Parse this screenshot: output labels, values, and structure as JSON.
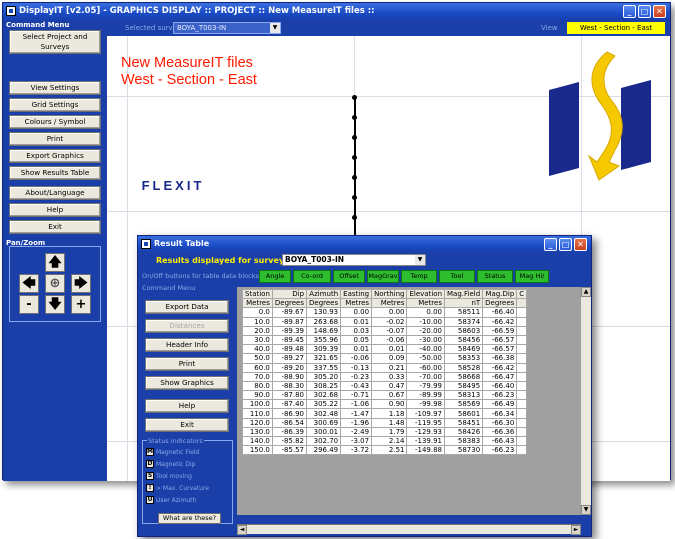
{
  "main": {
    "title": "DisplayIT [v2.05] - GRAPHICS DISPLAY :: PROJECT :: New MeasureIT files ::",
    "survey_label": "Selected survey",
    "survey_value": "BOYA_T003-IN",
    "view_label": "View",
    "view_value": "West - Section - East"
  },
  "command_menu": {
    "label": "Command Menu",
    "buttons": [
      "Select Project and Surveys",
      "View Settings",
      "Grid Settings",
      "Colours / Symbol",
      "Print",
      "Export Graphics",
      "Show Results Table",
      "About/Language",
      "Help",
      "Exit"
    ],
    "panzoom_label": "Pan/Zoom",
    "pan_up": "🡅",
    "pan_left": "🡄",
    "pan_center": "⊕",
    "pan_right": "🡆",
    "zoom_out": "-",
    "pan_down": "🡇",
    "zoom_in": "+"
  },
  "graphics": {
    "title_line1": "New MeasureIT files",
    "title_line2": "West - Section - East",
    "logo_text": "FLEXIT",
    "logo_colors": {
      "blue": "#1a2a8c",
      "yellow": "#f5c800"
    }
  },
  "result_window": {
    "title": "Result Table",
    "results_label": "Results displayed for survey",
    "survey_value": "BOYA_T003-IN",
    "onoff_label": "On/Off buttons for table data blocks",
    "toggles": [
      "Angle",
      "Co-ord",
      "Offset",
      "MagGrav",
      "Temp",
      "Tool",
      "Status",
      "Mag Hi/"
    ],
    "cmd_label": "Command Menu",
    "buttons": [
      "Export Data",
      "Distances",
      "Header Info",
      "Print",
      "Show Graphics",
      "Help",
      "Exit"
    ],
    "status_label": "Status indicators",
    "status_items": [
      {
        "icon": "M",
        "label": "Magnetic Field"
      },
      {
        "icon": "D",
        "label": "Magnetic Dip"
      },
      {
        "icon": "S",
        "label": "Tool moving"
      },
      {
        "icon": "!",
        "label": "> Max. Curvature"
      },
      {
        "icon": "U",
        "label": "User Azimuth"
      }
    ],
    "what_button": "What are these?"
  },
  "table": {
    "headers": [
      "Station",
      "Dip",
      "Azimuth",
      "Easting",
      "Northing",
      "Elevation",
      "Mag.Field",
      "Mag.Dip",
      "C"
    ],
    "units": [
      "Metres",
      "Degrees",
      "Degrees",
      "Metres",
      "Metres",
      "Metres",
      "nT",
      "Degrees",
      ""
    ],
    "rows": [
      [
        "0.0",
        "-89.67",
        "130.93",
        "0.00",
        "0.00",
        "0.00",
        "58511",
        "-66.40",
        ""
      ],
      [
        "10.0",
        "-89.87",
        "263.68",
        "0.01",
        "-0.02",
        "-10.00",
        "58374",
        "-66.42",
        ""
      ],
      [
        "20.0",
        "-89.39",
        "148.69",
        "0.03",
        "-0.07",
        "-20.00",
        "58603",
        "-66.59",
        ""
      ],
      [
        "30.0",
        "-89.45",
        "355.96",
        "0.05",
        "-0.06",
        "-30.00",
        "58456",
        "-66.57",
        ""
      ],
      [
        "40.0",
        "-89.48",
        "309.39",
        "0.01",
        "0.01",
        "-40.00",
        "58469",
        "-66.57",
        ""
      ],
      [
        "50.0",
        "-89.27",
        "321.65",
        "-0.06",
        "0.09",
        "-50.00",
        "58353",
        "-66.38",
        ""
      ],
      [
        "60.0",
        "-89.20",
        "337.55",
        "-0.13",
        "0.21",
        "-60.00",
        "58528",
        "-66.42",
        ""
      ],
      [
        "70.0",
        "-88.90",
        "305.20",
        "-0.23",
        "0.33",
        "-70.00",
        "58668",
        "-66.47",
        ""
      ],
      [
        "80.0",
        "-88.30",
        "308.25",
        "-0.43",
        "0.47",
        "-79.99",
        "58495",
        "-66.40",
        ""
      ],
      [
        "90.0",
        "-87.80",
        "302.68",
        "-0.71",
        "0.67",
        "-89.99",
        "58313",
        "-66.23",
        ""
      ],
      [
        "100.0",
        "-87.40",
        "305.22",
        "-1.06",
        "0.90",
        "-99.98",
        "58569",
        "-66.49",
        ""
      ],
      [
        "110.0",
        "-86.90",
        "302.48",
        "-1.47",
        "1.18",
        "-109.97",
        "58601",
        "-66.34",
        ""
      ],
      [
        "120.0",
        "-86.54",
        "300.69",
        "-1.96",
        "1.48",
        "-119.95",
        "58451",
        "-66.30",
        ""
      ],
      [
        "130.0",
        "-86.39",
        "300.01",
        "-2.49",
        "1.79",
        "-129.93",
        "58426",
        "-66.36",
        ""
      ],
      [
        "140.0",
        "-85.82",
        "302.70",
        "-3.07",
        "2.14",
        "-139.91",
        "58383",
        "-66.43",
        ""
      ],
      [
        "150.0",
        "-85.57",
        "296.49",
        "-3.72",
        "2.51",
        "-149.88",
        "58730",
        "-66.23",
        ""
      ]
    ]
  }
}
